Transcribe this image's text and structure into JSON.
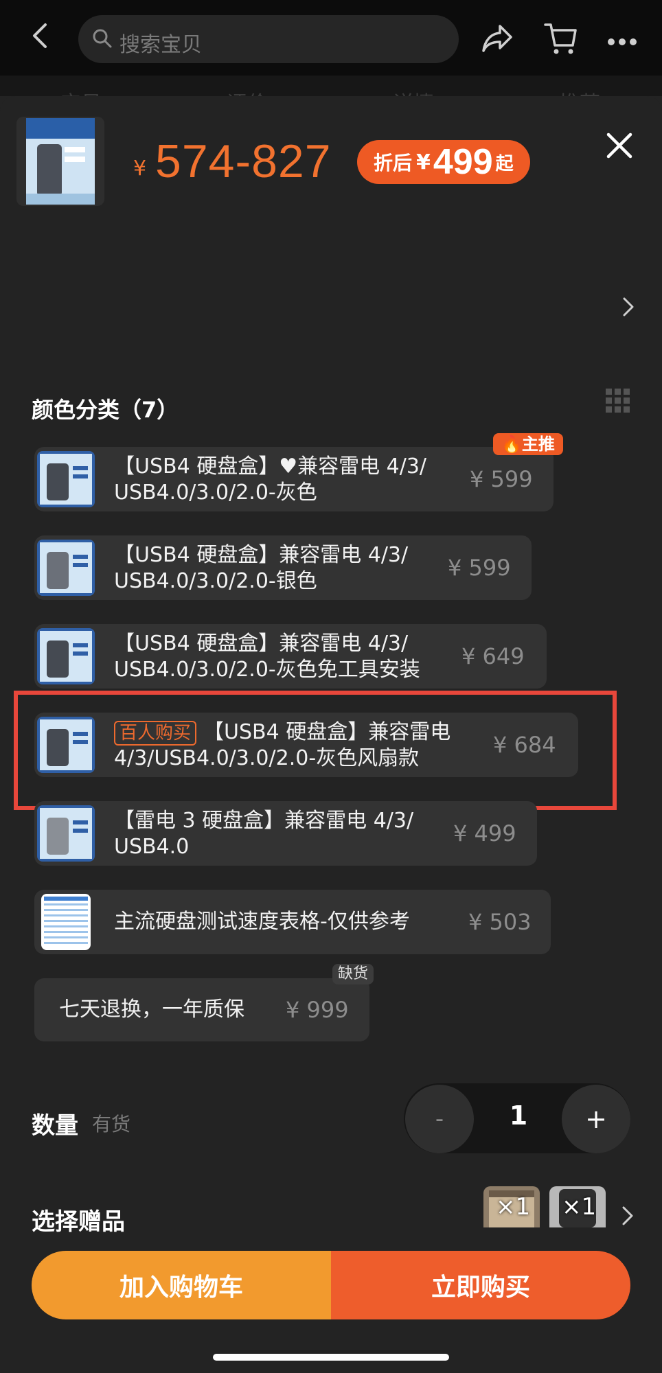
{
  "topbar": {
    "search_placeholder": "搜索宝贝",
    "icons": [
      "back-arrow-icon",
      "search-icon",
      "share-icon",
      "cart-icon",
      "more-icon"
    ],
    "tabs": [
      "宝贝",
      "评价",
      "详情",
      "推荐"
    ]
  },
  "header": {
    "currency": "¥",
    "price_range": "574-827",
    "discount_prefix": "折后",
    "discount_currency": "¥",
    "discount_price": "499",
    "discount_suffix": "起"
  },
  "color_section": {
    "title": "颜色分类（7）",
    "options": [
      {
        "line1": "【USB4 硬盘盒】♥兼容雷电 4/3/",
        "line2": "USB4.0/3.0/2.0-灰色",
        "price": "¥ 599",
        "badge": "主推"
      },
      {
        "line1": "【USB4 硬盘盒】兼容雷电 4/3/",
        "line2": "USB4.0/3.0/2.0-银色",
        "price": "¥ 599"
      },
      {
        "line1": "【USB4 硬盘盒】兼容雷电 4/3/",
        "line2": "USB4.0/3.0/2.0-灰色免工具安装",
        "price": "¥ 649"
      },
      {
        "tag": "百人购买",
        "line1": "【USB4 硬盘盒】兼容雷电",
        "line2": "4/3/USB4.0/3.0/2.0-灰色风扇款",
        "price": "¥ 684",
        "selected": true
      },
      {
        "line1": "【雷电 3 硬盘盒】兼容雷电 4/3/",
        "line2": "USB4.0",
        "price": "¥ 499"
      },
      {
        "line1": "主流硬盘测试速度表格-仅供参考",
        "price": "¥ 503"
      },
      {
        "line1": "七天退换，一年质保",
        "price": "¥ 999",
        "badge": "缺货"
      }
    ]
  },
  "quantity": {
    "label": "数量",
    "stock": "有货",
    "minus": "-",
    "value": "1",
    "plus": "+"
  },
  "gifts": {
    "label": "选择赠品",
    "items": [
      {
        "count": "×1"
      },
      {
        "count": "×1"
      }
    ]
  },
  "actions": {
    "add_to_cart": "加入购物车",
    "buy_now": "立即购买"
  },
  "colors": {
    "accent": "#f2722f",
    "discount_bg": "#ee5a24",
    "cart_button": "#f29a2e",
    "buy_button": "#ee5d2c",
    "highlight_border": "#e8473b"
  }
}
